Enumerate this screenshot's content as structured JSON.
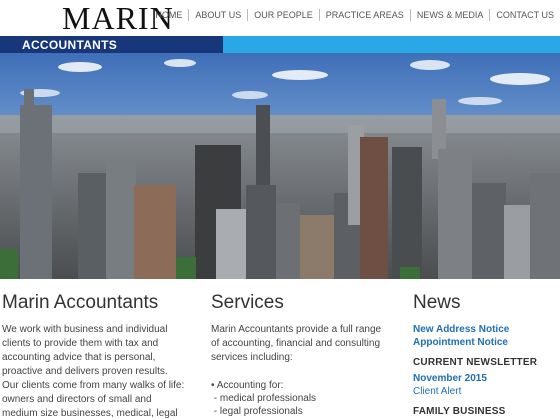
{
  "header": {
    "logo": "MARIN",
    "nav": [
      "HOME",
      "ABOUT US",
      "OUR PEOPLE",
      "PRACTICE AREAS",
      "NEWS & MEDIA",
      "CONTACT US"
    ]
  },
  "banner": {
    "label": "ACCOUNTANTS"
  },
  "colors": {
    "navy": "#17377a",
    "sky": "#2aa8e6",
    "link": "#1f6fb5"
  },
  "columns": {
    "about": {
      "title": "Marin Accountants",
      "text": "We work with business and individual clients to provide them with tax and accounting advice that is personal, proactive and delivers proven results. Our clients come from many walks of life: owners and directors of small and medium size businesses, medical, legal"
    },
    "services": {
      "title": "Services",
      "intro": "Marin Accountants provide a full range of accounting, financial and consulting services including:",
      "items": [
        "• Accounting for:",
        " - medical professionals",
        " - legal professionals"
      ]
    },
    "news": {
      "title": "News",
      "links": [
        "New Address Notice",
        "Appointment Notice"
      ],
      "newsletter_heading": "CURRENT NEWSLETTER",
      "newsletter_month": "November 2015",
      "newsletter_item": "Client Alert",
      "family_heading": "FAMILY BUSINESS SERVICES"
    }
  }
}
